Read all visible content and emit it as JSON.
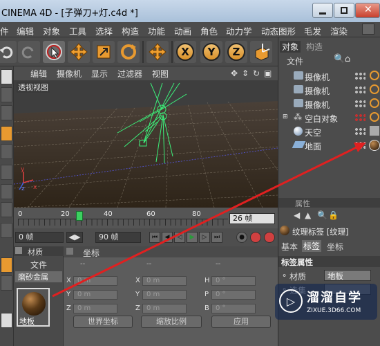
{
  "window": {
    "title": "CINEMA 4D - [子弹刀+灯.c4d *]"
  },
  "menu": [
    "件",
    "编辑",
    "对象",
    "工具",
    "选择",
    "构造",
    "功能",
    "动画",
    "角色",
    "动力学",
    "动态图形",
    "毛发",
    "渲染"
  ],
  "toolbar": {
    "x_label": "X",
    "y_label": "Y",
    "z_label": "Z"
  },
  "viewport": {
    "menu": [
      "编辑",
      "摄像机",
      "显示",
      "过滤器",
      "视图"
    ],
    "label": "透视视图",
    "axis_x": "x",
    "axis_y": "y",
    "axis_z": "z"
  },
  "timeline": {
    "ticks": [
      "0",
      "20",
      "40",
      "60",
      "80"
    ],
    "current_value": "26 帧"
  },
  "controls": {
    "start": "0 帧",
    "end": "90 帧"
  },
  "material_panel": {
    "header": "材质",
    "file_menu": "文件",
    "filter": "磨砂金属",
    "material_name": "地板"
  },
  "coord_panel": {
    "title": "坐标",
    "col_dashes": [
      "--",
      "--",
      "--"
    ],
    "rows": [
      {
        "a": "X",
        "av": "0 m",
        "b": "X",
        "bv": "0 m",
        "c": "H",
        "cv": "0 °"
      },
      {
        "a": "Y",
        "av": "0 m",
        "b": "Y",
        "bv": "0 m",
        "c": "P",
        "cv": "0 °"
      },
      {
        "a": "Z",
        "av": "0 m",
        "b": "Z",
        "bv": "0 m",
        "c": "B",
        "cv": "0 °"
      }
    ],
    "world_coord": "世界坐标",
    "scale_mode": "缩放比例",
    "apply": "应用"
  },
  "objects": {
    "tabs": [
      "对象",
      "构造"
    ],
    "file_menu": "文件",
    "items": [
      {
        "name": "摄像机"
      },
      {
        "name": "摄像机"
      },
      {
        "name": "摄像机"
      },
      {
        "name": "空白对象"
      },
      {
        "name": "天空"
      },
      {
        "name": "地面"
      }
    ]
  },
  "attributes": {
    "header": "属性",
    "tag_name": "纹理标签 [纹理]",
    "tabs": [
      "基本",
      "标签",
      "坐标"
    ],
    "section": "标签属性",
    "material_label": "材质",
    "material_value": "地板",
    "selection_label": "选集"
  },
  "watermark": {
    "brand": "溜溜自学",
    "url": "ZIXUE.3D66.COM"
  },
  "colors": {
    "accent": "#d8902a",
    "annotation_arrow": "#e02020",
    "selection_green": "#3cf07a"
  }
}
